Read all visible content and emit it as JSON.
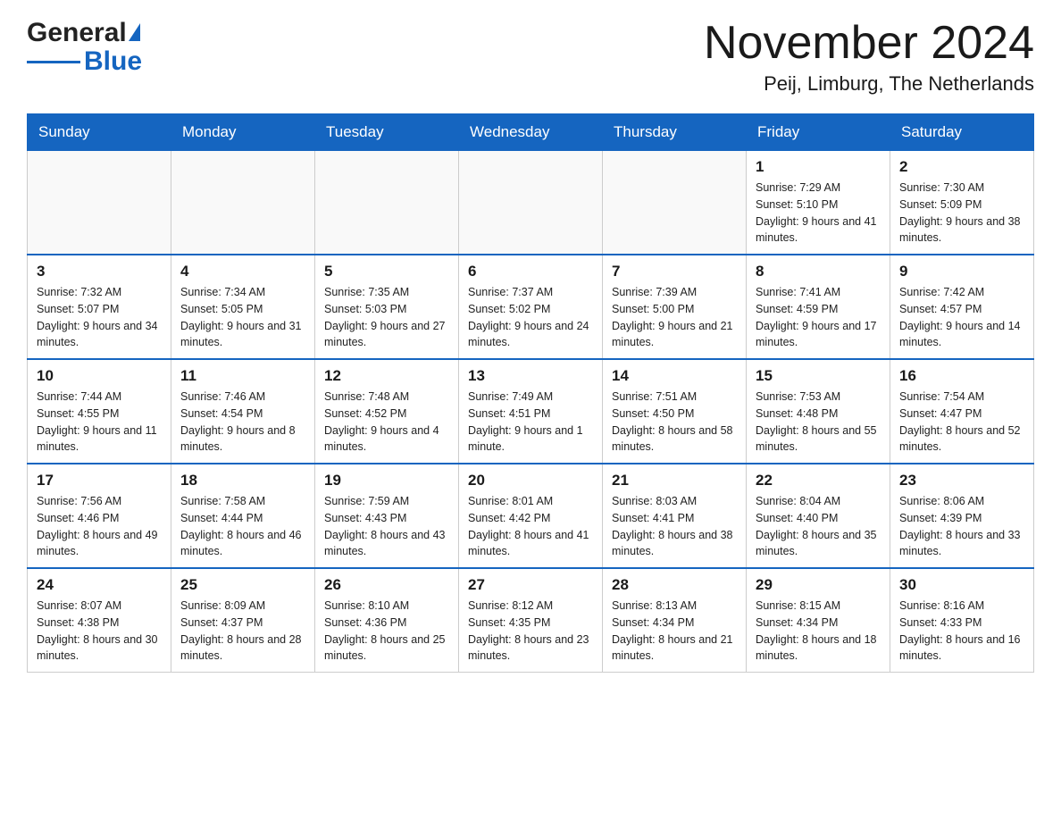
{
  "header": {
    "logo_general": "General",
    "logo_blue": "Blue",
    "month_title": "November 2024",
    "location": "Peij, Limburg, The Netherlands"
  },
  "days_of_week": [
    "Sunday",
    "Monday",
    "Tuesday",
    "Wednesday",
    "Thursday",
    "Friday",
    "Saturday"
  ],
  "weeks": [
    [
      {
        "day": "",
        "info": ""
      },
      {
        "day": "",
        "info": ""
      },
      {
        "day": "",
        "info": ""
      },
      {
        "day": "",
        "info": ""
      },
      {
        "day": "",
        "info": ""
      },
      {
        "day": "1",
        "info": "Sunrise: 7:29 AM\nSunset: 5:10 PM\nDaylight: 9 hours and 41 minutes."
      },
      {
        "day": "2",
        "info": "Sunrise: 7:30 AM\nSunset: 5:09 PM\nDaylight: 9 hours and 38 minutes."
      }
    ],
    [
      {
        "day": "3",
        "info": "Sunrise: 7:32 AM\nSunset: 5:07 PM\nDaylight: 9 hours and 34 minutes."
      },
      {
        "day": "4",
        "info": "Sunrise: 7:34 AM\nSunset: 5:05 PM\nDaylight: 9 hours and 31 minutes."
      },
      {
        "day": "5",
        "info": "Sunrise: 7:35 AM\nSunset: 5:03 PM\nDaylight: 9 hours and 27 minutes."
      },
      {
        "day": "6",
        "info": "Sunrise: 7:37 AM\nSunset: 5:02 PM\nDaylight: 9 hours and 24 minutes."
      },
      {
        "day": "7",
        "info": "Sunrise: 7:39 AM\nSunset: 5:00 PM\nDaylight: 9 hours and 21 minutes."
      },
      {
        "day": "8",
        "info": "Sunrise: 7:41 AM\nSunset: 4:59 PM\nDaylight: 9 hours and 17 minutes."
      },
      {
        "day": "9",
        "info": "Sunrise: 7:42 AM\nSunset: 4:57 PM\nDaylight: 9 hours and 14 minutes."
      }
    ],
    [
      {
        "day": "10",
        "info": "Sunrise: 7:44 AM\nSunset: 4:55 PM\nDaylight: 9 hours and 11 minutes."
      },
      {
        "day": "11",
        "info": "Sunrise: 7:46 AM\nSunset: 4:54 PM\nDaylight: 9 hours and 8 minutes."
      },
      {
        "day": "12",
        "info": "Sunrise: 7:48 AM\nSunset: 4:52 PM\nDaylight: 9 hours and 4 minutes."
      },
      {
        "day": "13",
        "info": "Sunrise: 7:49 AM\nSunset: 4:51 PM\nDaylight: 9 hours and 1 minute."
      },
      {
        "day": "14",
        "info": "Sunrise: 7:51 AM\nSunset: 4:50 PM\nDaylight: 8 hours and 58 minutes."
      },
      {
        "day": "15",
        "info": "Sunrise: 7:53 AM\nSunset: 4:48 PM\nDaylight: 8 hours and 55 minutes."
      },
      {
        "day": "16",
        "info": "Sunrise: 7:54 AM\nSunset: 4:47 PM\nDaylight: 8 hours and 52 minutes."
      }
    ],
    [
      {
        "day": "17",
        "info": "Sunrise: 7:56 AM\nSunset: 4:46 PM\nDaylight: 8 hours and 49 minutes."
      },
      {
        "day": "18",
        "info": "Sunrise: 7:58 AM\nSunset: 4:44 PM\nDaylight: 8 hours and 46 minutes."
      },
      {
        "day": "19",
        "info": "Sunrise: 7:59 AM\nSunset: 4:43 PM\nDaylight: 8 hours and 43 minutes."
      },
      {
        "day": "20",
        "info": "Sunrise: 8:01 AM\nSunset: 4:42 PM\nDaylight: 8 hours and 41 minutes."
      },
      {
        "day": "21",
        "info": "Sunrise: 8:03 AM\nSunset: 4:41 PM\nDaylight: 8 hours and 38 minutes."
      },
      {
        "day": "22",
        "info": "Sunrise: 8:04 AM\nSunset: 4:40 PM\nDaylight: 8 hours and 35 minutes."
      },
      {
        "day": "23",
        "info": "Sunrise: 8:06 AM\nSunset: 4:39 PM\nDaylight: 8 hours and 33 minutes."
      }
    ],
    [
      {
        "day": "24",
        "info": "Sunrise: 8:07 AM\nSunset: 4:38 PM\nDaylight: 8 hours and 30 minutes."
      },
      {
        "day": "25",
        "info": "Sunrise: 8:09 AM\nSunset: 4:37 PM\nDaylight: 8 hours and 28 minutes."
      },
      {
        "day": "26",
        "info": "Sunrise: 8:10 AM\nSunset: 4:36 PM\nDaylight: 8 hours and 25 minutes."
      },
      {
        "day": "27",
        "info": "Sunrise: 8:12 AM\nSunset: 4:35 PM\nDaylight: 8 hours and 23 minutes."
      },
      {
        "day": "28",
        "info": "Sunrise: 8:13 AM\nSunset: 4:34 PM\nDaylight: 8 hours and 21 minutes."
      },
      {
        "day": "29",
        "info": "Sunrise: 8:15 AM\nSunset: 4:34 PM\nDaylight: 8 hours and 18 minutes."
      },
      {
        "day": "30",
        "info": "Sunrise: 8:16 AM\nSunset: 4:33 PM\nDaylight: 8 hours and 16 minutes."
      }
    ]
  ]
}
